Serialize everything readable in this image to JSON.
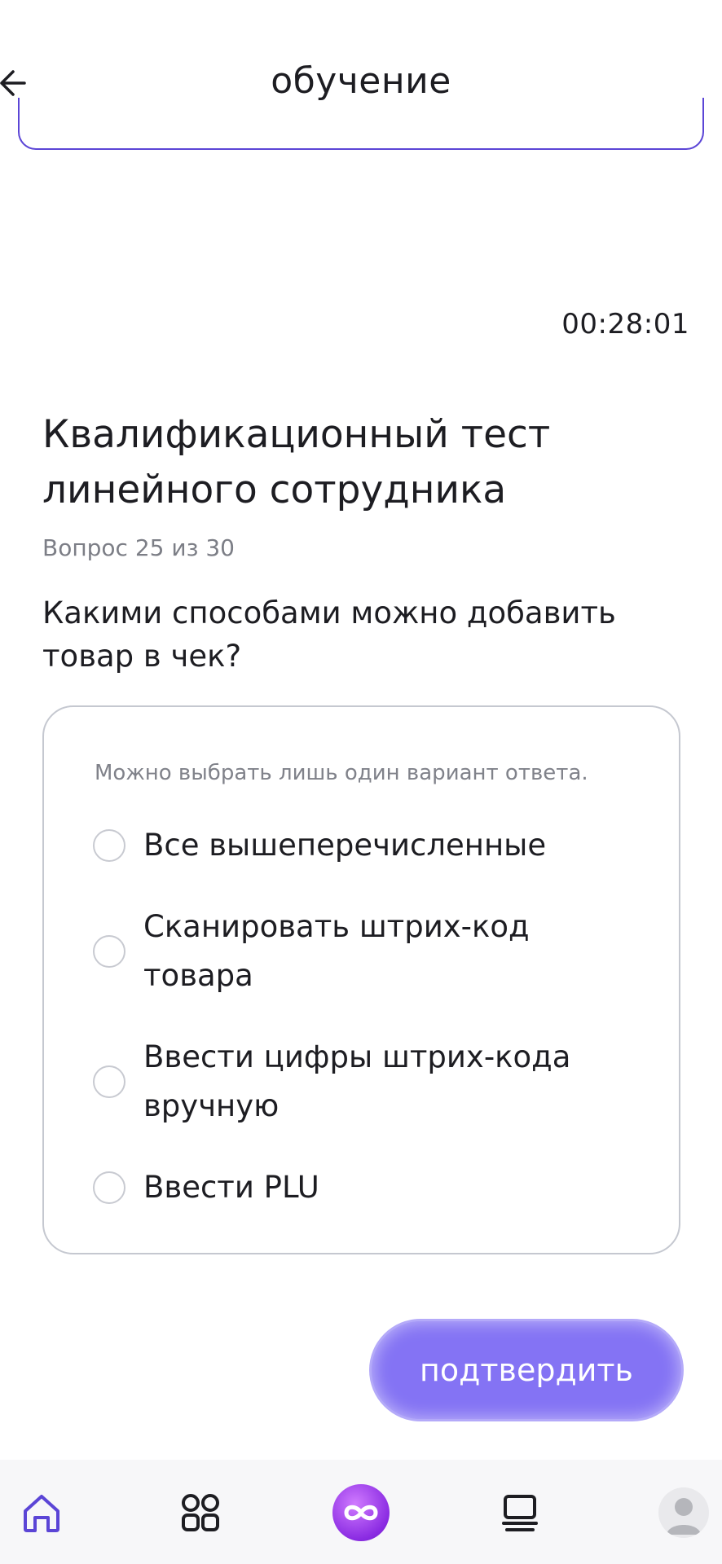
{
  "header": {
    "title": "обучение"
  },
  "timer": "00:28:01",
  "test": {
    "title_line1": "Квалификационный тест",
    "title_line2": "линейного сотрудника",
    "progress": "Вопрос 25 из 30",
    "question": "Какими способами можно добавить товар в чек?"
  },
  "answers": {
    "hint": "Можно выбрать лишь один вариант ответа.",
    "options": [
      {
        "label": "Все вышеперечисленные",
        "selected": false
      },
      {
        "label": "Сканировать штрих-код товара",
        "selected": false
      },
      {
        "label": "Ввести цифры штрих-кода вручную",
        "selected": false
      },
      {
        "label": "Ввести PLU",
        "selected": false
      }
    ]
  },
  "actions": {
    "confirm_label": "подтвердить"
  },
  "nav": {
    "items": [
      "home-icon",
      "grid-icon",
      "app-logo-icon",
      "courses-icon",
      "profile-avatar"
    ],
    "active": "home-icon"
  },
  "colors": {
    "accent": "#5b45d6",
    "button": "#8473f4",
    "nav_active": "#5b45d6"
  }
}
